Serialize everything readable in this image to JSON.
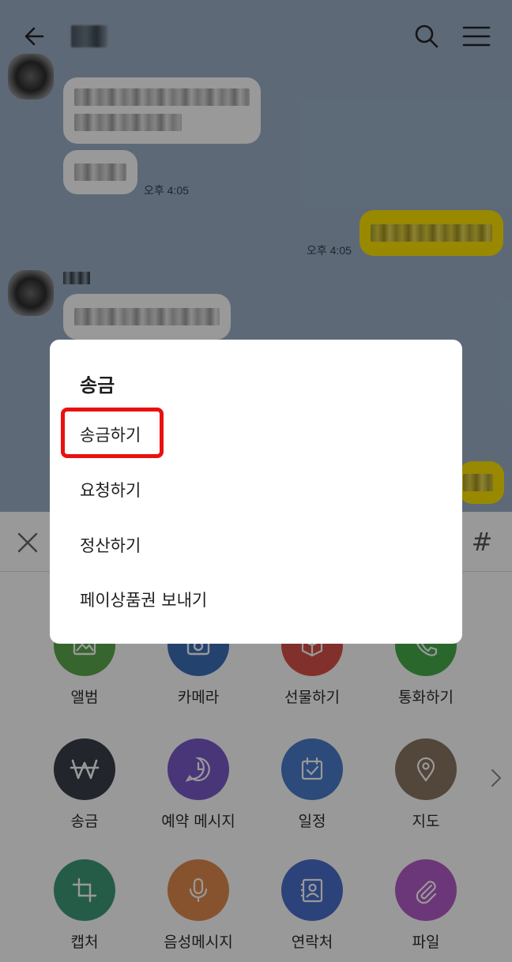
{
  "header": {
    "back_icon": "arrow-left-icon",
    "search_icon": "search-icon",
    "menu_icon": "hamburger-menu-icon"
  },
  "chat": {
    "messages": [
      {
        "side": "left",
        "time": "오후 4:05"
      },
      {
        "side": "right",
        "time": "오후 4:05"
      }
    ]
  },
  "panel": {
    "close_icon": "close-icon",
    "hash_label": "#",
    "items": [
      {
        "label": "앨범",
        "icon": "album-icon",
        "color": "#5ba84b"
      },
      {
        "label": "카메라",
        "icon": "camera-icon",
        "color": "#3d6fb8"
      },
      {
        "label": "선물하기",
        "icon": "gift-icon",
        "color": "#d9504a"
      },
      {
        "label": "통화하기",
        "icon": "phone-icon",
        "color": "#46ac4c"
      },
      {
        "label": "송금",
        "icon": "won-icon",
        "color": "#3a3f4a"
      },
      {
        "label": "예약 메시지",
        "icon": "clock-message-icon",
        "color": "#7b5ac8"
      },
      {
        "label": "일정",
        "icon": "calendar-check-icon",
        "color": "#4a7ccc"
      },
      {
        "label": "지도",
        "icon": "location-pin-icon",
        "color": "#8a7561"
      },
      {
        "label": "캡처",
        "icon": "crop-icon",
        "color": "#3e9a78"
      },
      {
        "label": "음성메시지",
        "icon": "microphone-icon",
        "color": "#e08a4e"
      },
      {
        "label": "연락처",
        "icon": "contact-card-icon",
        "color": "#4a6fcc"
      },
      {
        "label": "파일",
        "icon": "paperclip-icon",
        "color": "#b45cc8"
      }
    ]
  },
  "dialog": {
    "title": "송금",
    "options": [
      "송금하기",
      "요청하기",
      "정산하기",
      "페이상품권 보내기"
    ],
    "highlight_color": "#ea1010"
  }
}
